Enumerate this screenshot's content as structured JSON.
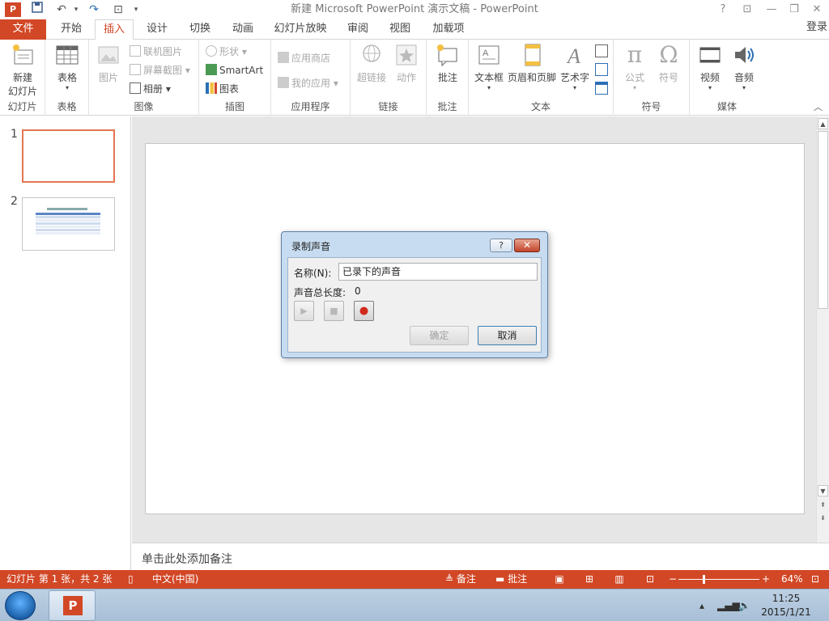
{
  "window": {
    "title": "新建 Microsoft PowerPoint 演示文稿 - PowerPoint",
    "app_icon_text": "P",
    "controls": [
      "?",
      "⊡",
      "—",
      "❐",
      "✕"
    ]
  },
  "quick_access": {
    "save_glyph": "💾",
    "undo_glyph": "↶",
    "redo_glyph": "↷",
    "present_glyph": "⊡",
    "more_glyph": "▾"
  },
  "tabs": [
    "文件",
    "开始",
    "插入",
    "设计",
    "切换",
    "动画",
    "幻灯片放映",
    "审阅",
    "视图",
    "加载项"
  ],
  "active_tab": "插入",
  "login": "登录",
  "ribbon": {
    "slides": {
      "new_slide_line1": "新建",
      "new_slide_line2": "幻灯片",
      "group": "幻灯片"
    },
    "tables": {
      "table": "表格",
      "group": "表格"
    },
    "images": {
      "picture": "图片",
      "online_pictures": "联机图片",
      "screenshot": "屏幕截图",
      "album": "相册",
      "group": "图像"
    },
    "illustrations": {
      "shapes": "形状",
      "smartart": "SmartArt",
      "chart": "图表",
      "group": "插图"
    },
    "apps": {
      "store": "应用商店",
      "my_apps": "我的应用",
      "group": "应用程序"
    },
    "links": {
      "hyperlink": "超链接",
      "action": "动作",
      "group": "链接"
    },
    "comments": {
      "comment": "批注",
      "group": "批注"
    },
    "text": {
      "textbox": "文本框",
      "header_footer": "页眉和页脚",
      "wordart": "艺术字",
      "group": "文本"
    },
    "symbols": {
      "equation": "公式",
      "symbol": "符号",
      "group": "符号",
      "equation_glyph": "π",
      "symbol_glyph": "Ω"
    },
    "media": {
      "video": "视频",
      "audio": "音频",
      "group": "媒体"
    }
  },
  "thumbnails": [
    {
      "number": "1"
    },
    {
      "number": "2"
    }
  ],
  "notes_placeholder": "单击此处添加备注",
  "status": {
    "slide_info": "幻灯片 第 1 张，共 2 张",
    "language": "中文(中国)",
    "notes": "备注",
    "comments": "批注",
    "zoom_minus": "−",
    "zoom_plus": "+",
    "zoom": "64%"
  },
  "dialog": {
    "title": "录制声音",
    "help": "?",
    "close": "✕",
    "name_label": "名称(N):",
    "name_value": "已录下的声音",
    "length_label": "声音总长度:",
    "length_value": "0",
    "play_glyph": "▶",
    "stop_glyph": "■",
    "record_glyph": "●",
    "ok": "确定",
    "cancel": "取消"
  },
  "taskbar": {
    "time": "11:25",
    "date": "2015/1/21"
  },
  "colors": {
    "accent": "#d24726",
    "thumb_selected": "#e47651",
    "slide_bg": "#e6e6e6"
  }
}
